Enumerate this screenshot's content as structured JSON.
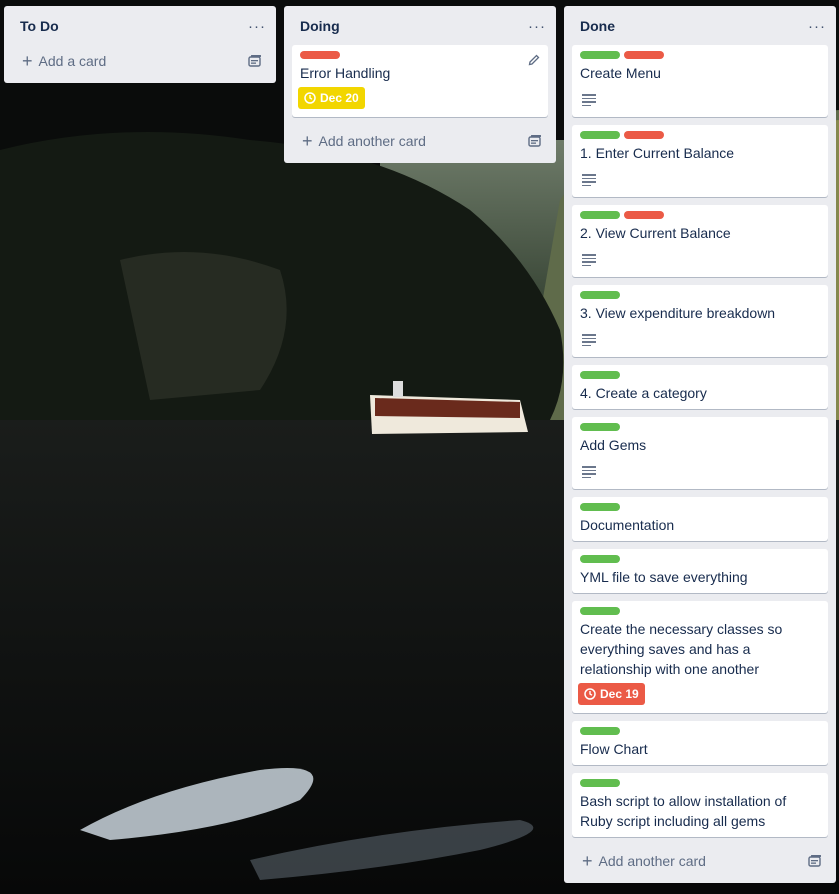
{
  "lists": [
    {
      "title": "To Do",
      "menu": "···",
      "add_label": "Add a card",
      "cards": []
    },
    {
      "title": "Doing",
      "menu": "···",
      "add_label": "Add another card",
      "cards": [
        {
          "labels": [
            "red"
          ],
          "title": "Error Handling",
          "due": "Dec 20",
          "due_color": "yellow"
        }
      ]
    },
    {
      "title": "Done",
      "menu": "···",
      "add_label": "Add another card",
      "cards": [
        {
          "labels": [
            "green",
            "red"
          ],
          "title": "Create Menu",
          "description": true
        },
        {
          "labels": [
            "green",
            "red"
          ],
          "title": "1. Enter Current Balance",
          "description": true
        },
        {
          "labels": [
            "green",
            "red"
          ],
          "title": "2. View Current Balance",
          "description": true
        },
        {
          "labels": [
            "green"
          ],
          "title": "3. View expenditure breakdown",
          "description": true
        },
        {
          "labels": [
            "green"
          ],
          "title": "4. Create a category"
        },
        {
          "labels": [
            "green"
          ],
          "title": "Add Gems",
          "description": true
        },
        {
          "labels": [
            "green"
          ],
          "title": "Documentation"
        },
        {
          "labels": [
            "green"
          ],
          "title": "YML file to save everything"
        },
        {
          "labels": [
            "green"
          ],
          "title": "Create the necessary classes so everything saves and has a relationship with one another",
          "due": "Dec 19",
          "due_color": "red"
        },
        {
          "labels": [
            "green"
          ],
          "title": "Flow Chart"
        },
        {
          "labels": [
            "green"
          ],
          "title": "Bash script to allow installation of Ruby script including all gems"
        }
      ]
    }
  ],
  "colors": {
    "label_green": "#61bd4f",
    "label_red": "#eb5a46",
    "due_yellow": "#f2d600",
    "due_red": "#eb5a46",
    "list_bg": "#ebecf0"
  }
}
